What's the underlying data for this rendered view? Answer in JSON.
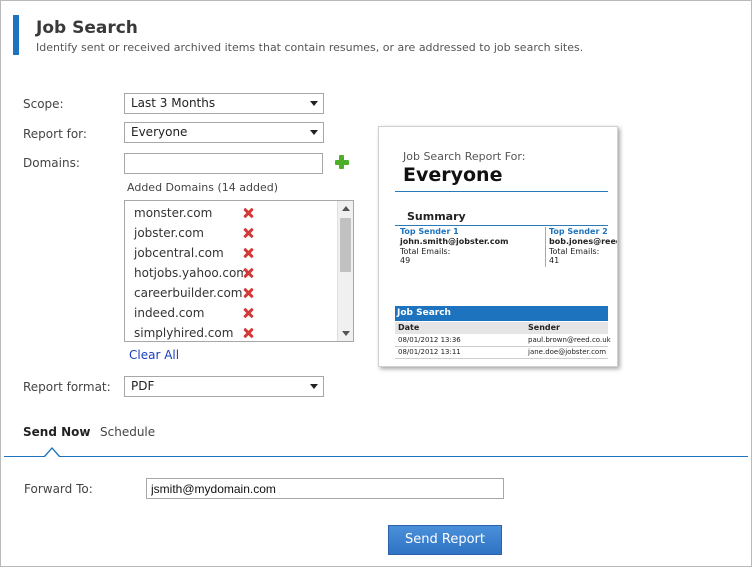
{
  "header": {
    "title": "Job Search",
    "subtitle": "Identify sent or received archived items that contain resumes, or are addressed to job search sites."
  },
  "form": {
    "scope_label": "Scope:",
    "scope_value": "Last 3 Months",
    "report_for_label": "Report for:",
    "report_for_value": "Everyone",
    "domains_label": "Domains:",
    "domain_input_value": "",
    "added_domains_caption": "Added Domains (14 added)",
    "domains": [
      "monster.com",
      "jobster.com",
      "jobcentral.com",
      "hotjobs.yahoo.com",
      "careerbuilder.com",
      "indeed.com",
      "simplyhired.com"
    ],
    "clear_all": "Clear All",
    "report_format_label": "Report format:",
    "report_format_value": "PDF"
  },
  "preview": {
    "report_for": "Job Search Report For:",
    "recipient": "Everyone",
    "summary": "Summary",
    "sender1_head": "Top Sender 1",
    "sender1_email": "john.smith@jobster.com",
    "sender1_label": "Total Emails:",
    "sender1_count": "49",
    "sender2_head": "Top Sender 2",
    "sender2_email": "bob.jones@reed.",
    "sender2_label": "Total Emails:",
    "sender2_count": "41",
    "section": "Job Search",
    "col_date": "Date",
    "col_sender": "Sender",
    "rows": [
      {
        "date": "08/01/2012 13:36",
        "sender": "paul.brown@reed.co.uk"
      },
      {
        "date": "08/01/2012 13:11",
        "sender": "jane.doe@jobster.com"
      }
    ]
  },
  "tabs": {
    "send_now": "Send Now",
    "schedule": "Schedule"
  },
  "send": {
    "forward_label": "Forward To:",
    "forward_value": "jsmith@mydomain.com",
    "button_label": "Send Report"
  },
  "colors": {
    "accent": "#1e73be",
    "add": "#4caf27",
    "remove": "#d23a3a",
    "link": "#1a3fbf"
  }
}
